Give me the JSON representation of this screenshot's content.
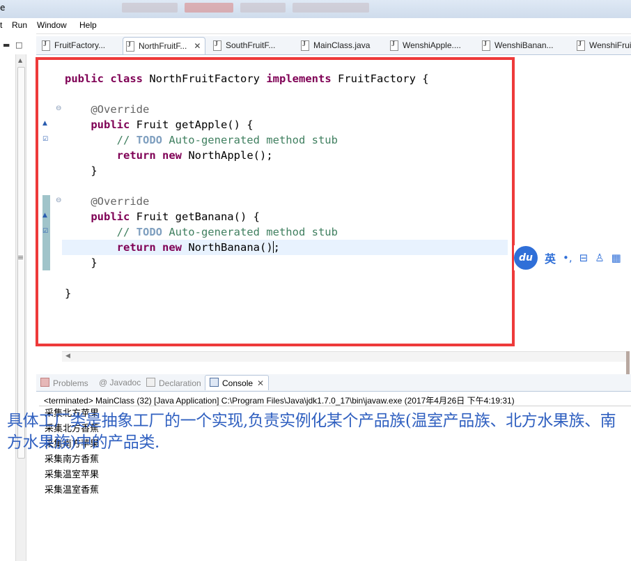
{
  "window": {
    "title_fragment": "e"
  },
  "menubar": {
    "items": [
      "t",
      "Run",
      "Window",
      "Help"
    ]
  },
  "editor_tabs": [
    {
      "label": "FruitFactory...",
      "active": false
    },
    {
      "label": "NorthFruitF...",
      "active": true
    },
    {
      "label": "SouthFruitF...",
      "active": false
    },
    {
      "label": "MainClass.java",
      "active": false
    },
    {
      "label": "WenshiApple....",
      "active": false
    },
    {
      "label": "WenshiBanan...",
      "active": false
    },
    {
      "label": "WenshiFruit",
      "active": false
    }
  ],
  "code": {
    "line1": {
      "kw1": "public",
      "kw2": "class",
      "name": " NorthFruitFactory ",
      "kw3": "implements",
      "rest": " FruitFactory {"
    },
    "override": "@Override",
    "m1": {
      "kw": "public",
      "sig": " Fruit getApple() {",
      "cmt_prefix": "// ",
      "todo": "TODO",
      "cmt_rest": " Auto-generated method stub",
      "ret_kw": "return",
      "new_kw": "new",
      "ret_rest": " NorthApple();"
    },
    "m2": {
      "kw": "public",
      "sig": " Fruit getBanana() {",
      "cmt_prefix": "// ",
      "todo": "TODO",
      "cmt_rest": " Auto-generated method stub",
      "ret_kw": "return",
      "new_kw": "new",
      "ret_rest_a": " NorthBanana()",
      "ret_rest_b": ";"
    },
    "close_brace": "}"
  },
  "ime_toolbar": {
    "logo": "du",
    "lang": "英",
    "punct": "•,"
  },
  "view_tabs": [
    {
      "label": "Problems",
      "active": false
    },
    {
      "label": "Javadoc",
      "active": false
    },
    {
      "label": "Declaration",
      "active": false
    },
    {
      "label": "Console",
      "active": true
    }
  ],
  "console": {
    "header": "<terminated> MainClass (32) [Java Application] C:\\Program Files\\Java\\jdk1.7.0_17\\bin\\javaw.exe (2017年4月26日 下午4:19:31)",
    "lines": [
      "采集北方苹果",
      "采集北方香蕉",
      "采集南方苹果",
      "采集南方香蕉",
      "采集温室苹果",
      "采集温室香蕉"
    ]
  },
  "overlay_text": "具体工厂类是抽象工厂的一个实现,负责实例化某个产品族(温室产品族、北方水果族、南方水果族)中的产品类."
}
